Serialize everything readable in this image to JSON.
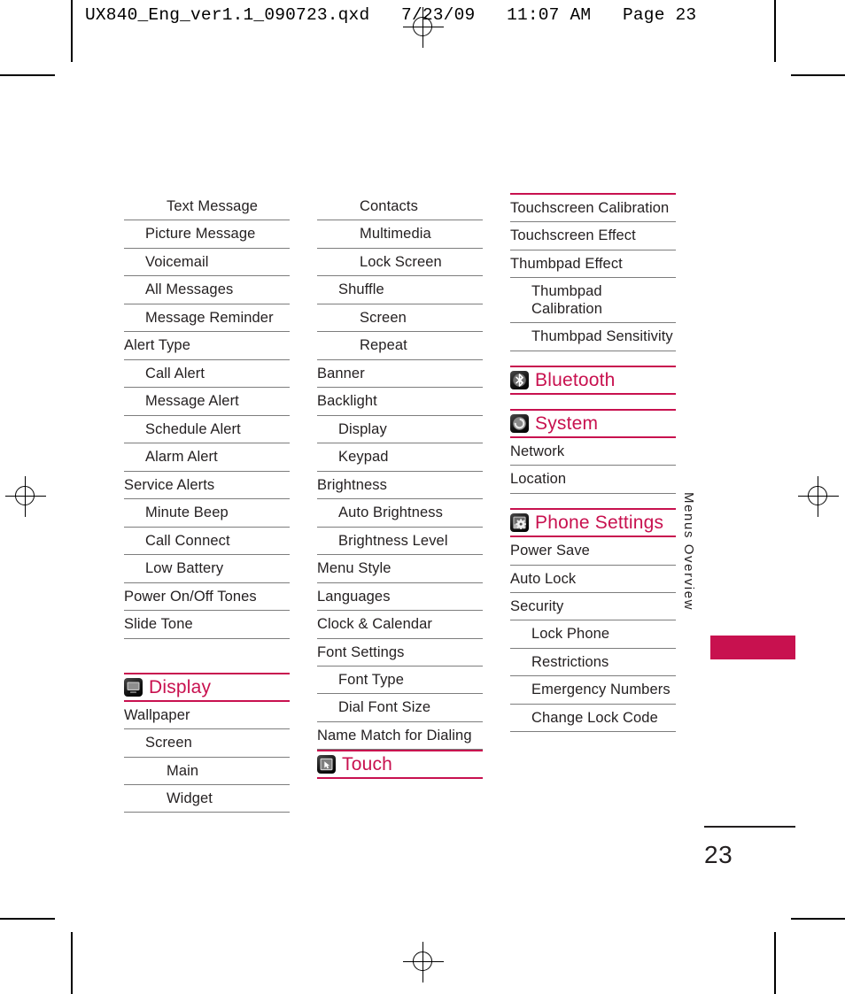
{
  "header": {
    "slug": "UX840_Eng_ver1.1_090723.qxd   7/23/09   11:07 AM   Page 23"
  },
  "rail": {
    "label": "Menus Overview"
  },
  "folio": {
    "page_number": "23"
  },
  "colors": {
    "accent": "#c8114f",
    "text": "#231f20",
    "rule": "#7d7d7d"
  },
  "columns": [
    {
      "id": "column-1",
      "blocks": [
        {
          "kind": "rows",
          "rows": [
            {
              "label": "Text Message",
              "level": 2
            },
            {
              "label": "Picture Message",
              "level": 1
            },
            {
              "label": "Voicemail",
              "level": 1
            },
            {
              "label": "All Messages",
              "level": 1
            },
            {
              "label": "Message Reminder",
              "level": 1
            },
            {
              "label": "Alert Type",
              "level": 0
            },
            {
              "label": "Call Alert",
              "level": 1
            },
            {
              "label": "Message Alert",
              "level": 1
            },
            {
              "label": "Schedule Alert",
              "level": 1
            },
            {
              "label": "Alarm Alert",
              "level": 1
            },
            {
              "label": "Service Alerts",
              "level": 0
            },
            {
              "label": "Minute Beep",
              "level": 1
            },
            {
              "label": "Call Connect",
              "level": 1
            },
            {
              "label": "Low Battery",
              "level": 1
            },
            {
              "label": "Power On/Off Tones",
              "level": 0
            },
            {
              "label": "Slide Tone",
              "level": 0
            }
          ]
        },
        {
          "kind": "gap",
          "size": "lg"
        },
        {
          "kind": "section",
          "title": "Display",
          "icon": "display-icon"
        },
        {
          "kind": "rows",
          "rows": [
            {
              "label": "Wallpaper",
              "level": 0
            },
            {
              "label": "Screen",
              "level": 1
            },
            {
              "label": "Main",
              "level": 2
            },
            {
              "label": "Widget",
              "level": 2
            }
          ]
        }
      ]
    },
    {
      "id": "column-2",
      "blocks": [
        {
          "kind": "rows",
          "rows": [
            {
              "label": "Contacts",
              "level": 2
            },
            {
              "label": "Multimedia",
              "level": 2
            },
            {
              "label": "Lock Screen",
              "level": 2
            },
            {
              "label": "Shuffle",
              "level": 1
            },
            {
              "label": "Screen",
              "level": 2
            },
            {
              "label": "Repeat",
              "level": 2
            },
            {
              "label": "Banner",
              "level": 0
            },
            {
              "label": "Backlight",
              "level": 0
            },
            {
              "label": "Display",
              "level": 1
            },
            {
              "label": "Keypad",
              "level": 1
            },
            {
              "label": "Brightness",
              "level": 0
            },
            {
              "label": "Auto Brightness",
              "level": 1
            },
            {
              "label": "Brightness Level",
              "level": 1
            },
            {
              "label": "Menu Style",
              "level": 0
            },
            {
              "label": "Languages",
              "level": 0
            },
            {
              "label": "Clock & Calendar",
              "level": 0
            },
            {
              "label": "Font Settings",
              "level": 0
            },
            {
              "label": "Font Type",
              "level": 1
            },
            {
              "label": "Dial Font Size",
              "level": 1
            },
            {
              "label": "Name Match for Dialing",
              "level": 0
            }
          ]
        },
        {
          "kind": "section",
          "title": "Touch",
          "icon": "touch-icon"
        }
      ]
    },
    {
      "id": "column-3",
      "blocks": [
        {
          "kind": "topline"
        },
        {
          "kind": "rows",
          "rows": [
            {
              "label": "Touchscreen Calibration",
              "level": 0
            },
            {
              "label": "Touchscreen Effect",
              "level": 0
            },
            {
              "label": "Thumbpad Effect",
              "level": 0
            },
            {
              "label": "Thumbpad Calibration",
              "level": 1
            },
            {
              "label": "Thumbpad Sensitivity",
              "level": 1
            }
          ]
        },
        {
          "kind": "gap",
          "size": "sm"
        },
        {
          "kind": "section",
          "title": "Bluetooth",
          "icon": "bluetooth-icon"
        },
        {
          "kind": "gap",
          "size": "sm"
        },
        {
          "kind": "section",
          "title": "System",
          "icon": "system-icon"
        },
        {
          "kind": "rows",
          "rows": [
            {
              "label": "Network",
              "level": 0
            },
            {
              "label": "Location",
              "level": 0
            }
          ]
        },
        {
          "kind": "gap",
          "size": "sm"
        },
        {
          "kind": "section",
          "title": "Phone Settings",
          "icon": "phone-settings-icon"
        },
        {
          "kind": "rows",
          "rows": [
            {
              "label": "Power Save",
              "level": 0
            },
            {
              "label": "Auto Lock",
              "level": 0
            },
            {
              "label": "Security",
              "level": 0
            },
            {
              "label": "Lock Phone",
              "level": 1
            },
            {
              "label": "Restrictions",
              "level": 1
            },
            {
              "label": "Emergency Numbers",
              "level": 1
            },
            {
              "label": "Change Lock Code",
              "level": 1
            }
          ]
        }
      ]
    }
  ]
}
